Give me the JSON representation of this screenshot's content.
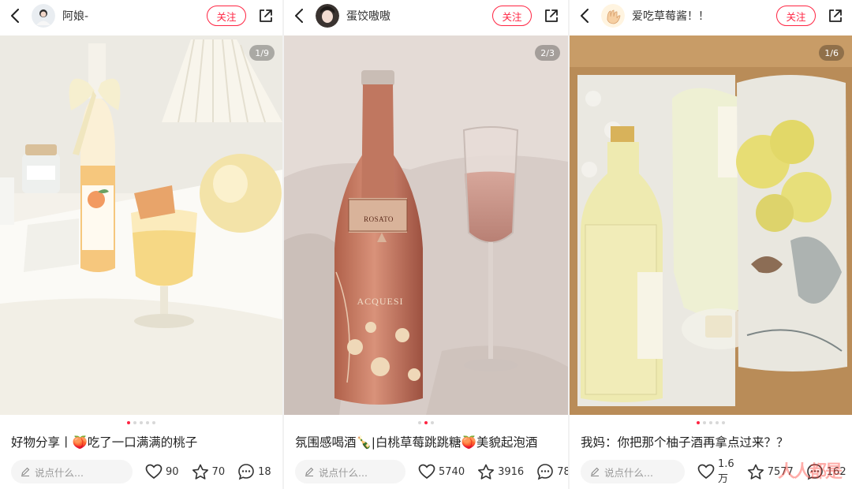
{
  "posts": [
    {
      "author": "阿娘-",
      "follow_label": "关注",
      "image_counter": "1/9",
      "title": "好物分享丨🍑吃了一口满满的桃子",
      "comment_placeholder": "说点什么...",
      "likes": "90",
      "collects": "70",
      "comments": "18"
    },
    {
      "author": "蛋饺嗷嗷",
      "follow_label": "关注",
      "image_counter": "2/3",
      "title": "氛围感喝酒🍾|白桃草莓跳跳糖🍑美貌起泡酒",
      "comment_placeholder": "说点什么...",
      "likes": "5740",
      "collects": "3916",
      "comments": "78"
    },
    {
      "author": "爱吃草莓酱！！",
      "follow_label": "关注",
      "image_counter": "1/6",
      "title": "我妈：你把那个柚子酒再拿点过来？？",
      "comment_placeholder": "说点什么...",
      "likes": "1.6万",
      "collects": "7577",
      "comments": "162"
    }
  ],
  "label_bottle": {
    "brand": "ACQUESI",
    "variety": "ROSATO"
  },
  "watermark": "人人都是"
}
